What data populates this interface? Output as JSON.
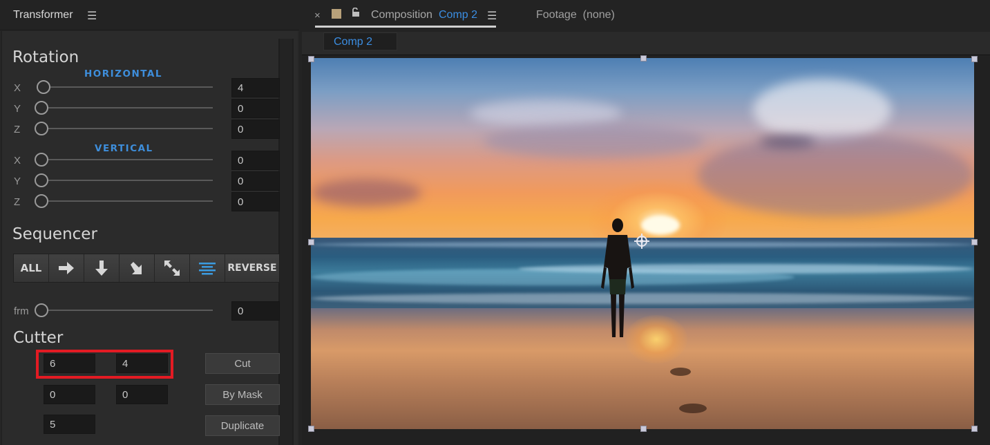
{
  "panel": {
    "title": "Transformer",
    "menu_icon": "☰"
  },
  "rotation": {
    "title": "Rotation",
    "horizontal_label": "HORIZONTAL",
    "vertical_label": "VERTICAL",
    "horizontal": {
      "x": {
        "axis": "X",
        "value": "4"
      },
      "y": {
        "axis": "Y",
        "value": "0"
      },
      "z": {
        "axis": "Z",
        "value": "0"
      }
    },
    "vertical": {
      "x": {
        "axis": "X",
        "value": "0"
      },
      "y": {
        "axis": "Y",
        "value": "0"
      },
      "z": {
        "axis": "Z",
        "value": "0"
      }
    }
  },
  "sequencer": {
    "title": "Sequencer",
    "all_label": "ALL",
    "reverse_label": "REVERSE",
    "icons": [
      "arrow-right-icon",
      "arrow-down-icon",
      "arrow-down-right-icon",
      "arrow-expand-icon",
      "align-center-icon"
    ],
    "frm_label": "frm",
    "frm_value": "0"
  },
  "cutter": {
    "title": "Cutter",
    "row1": [
      "6",
      "4"
    ],
    "row2": [
      "0",
      "0"
    ],
    "row3": [
      "5"
    ],
    "cut_label": "Cut",
    "by_mask_label": "By Mask",
    "duplicate_label": "Duplicate"
  },
  "composition": {
    "close_icon": "×",
    "tab_label": "Composition",
    "tab_name": "Comp 2",
    "menu_icon": "☰",
    "footage_label": "Footage",
    "footage_value": "(none)",
    "breadcrumb": "Comp 2"
  },
  "colors": {
    "accent": "#3b8ee3",
    "highlight": "#e31b23",
    "panel_bg": "#2b2b2b"
  }
}
